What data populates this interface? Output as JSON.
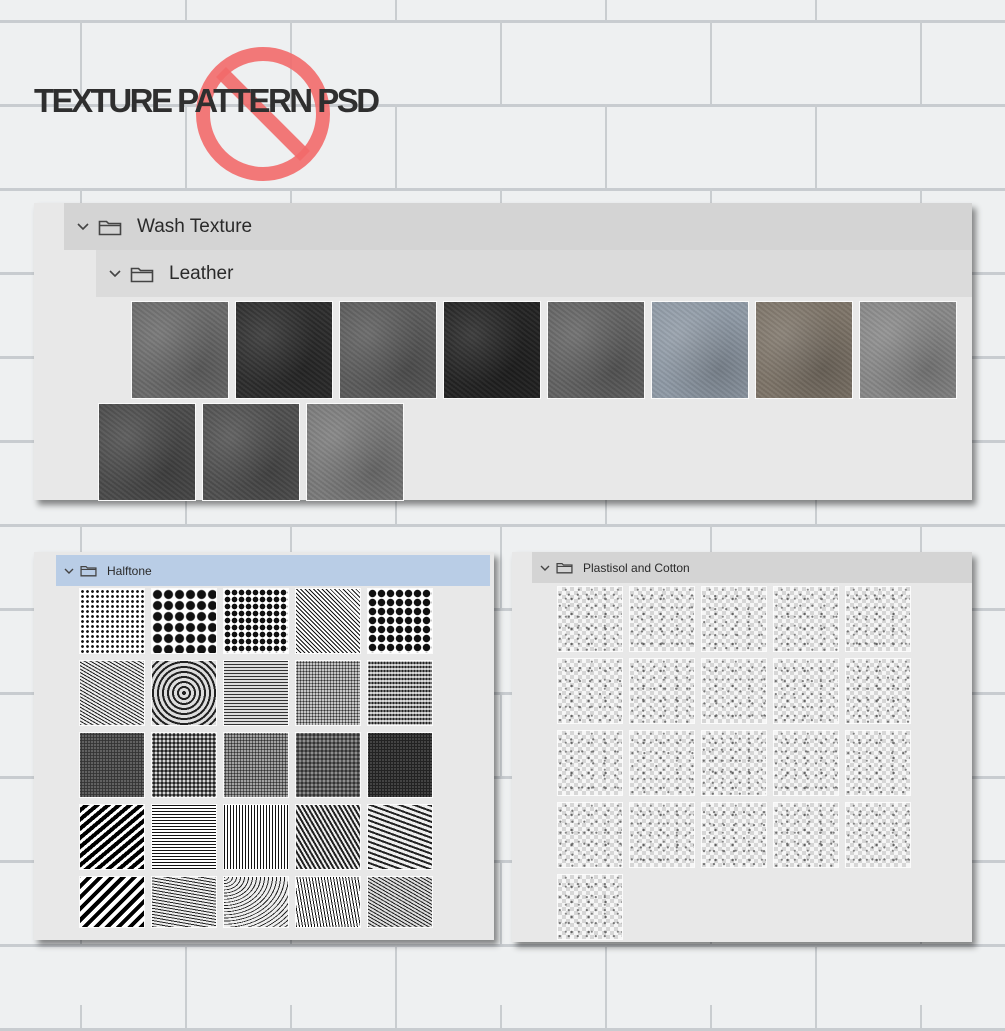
{
  "title": "TEXTURE PATTERN PSD",
  "icons": {
    "folder": "folder-icon",
    "chevron": "chevron-down-icon",
    "prohibited": "prohibited-sign-icon"
  },
  "colors": {
    "panel_bg": "#e8e8e8",
    "header_bg": "#d4d4d4",
    "selected_bg": "#b9cde6",
    "no_sign": "#f26a6a"
  },
  "wash_panel": {
    "group_label": "Wash Texture",
    "subgroup_label": "Leather",
    "swatches": [
      "#6a6a6a",
      "#2c2c2c",
      "#5b5b5b",
      "#232323",
      "#626262",
      "#8f9aa6",
      "#7d7468",
      "#888888",
      "#4a4a4a",
      "#4f4f4f",
      "#7a7a7a"
    ]
  },
  "halftone_panel": {
    "group_label": "Halftone",
    "rows": 5,
    "cols": 5
  },
  "plastisol_panel": {
    "group_label": "Plastisol and Cotton",
    "rows": 5,
    "cols": 5,
    "count": 21
  }
}
